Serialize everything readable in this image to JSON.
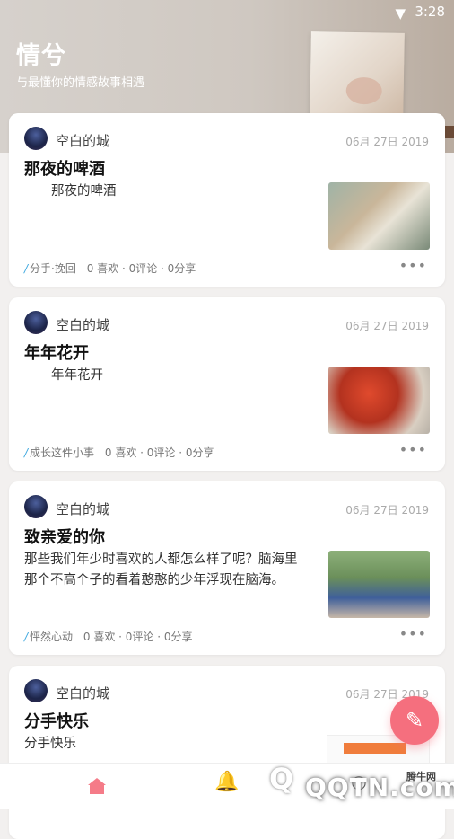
{
  "status_bar": {
    "time": "3:28",
    "wifi_icon": "wifi-icon"
  },
  "header": {
    "title": "情兮",
    "subtitle": "与最懂你的情感故事相遇"
  },
  "posts": [
    {
      "author": "空白的城",
      "date": "06月 27日 2019",
      "title": "那夜的啤酒",
      "body": "那夜的啤酒",
      "category": "分手·挽回",
      "stats": "0 喜欢 · 0评论 · 0分享",
      "thumb": "beer-photo"
    },
    {
      "author": "空白的城",
      "date": "06月 27日 2019",
      "title": "年年花开",
      "body": "年年花开",
      "category": "成长这件小事",
      "stats": "0 喜欢 · 0评论 · 0分享",
      "thumb": "flower-photo"
    },
    {
      "author": "空白的城",
      "date": "06月 27日 2019",
      "title": "致亲爱的你",
      "body": "那些我们年少时喜欢的人都怎么样了呢？脑海里那个不高个子的看着憨憨的少年浮现在脑海。",
      "category": "怦然心动",
      "stats": "0 喜欢 · 0评论 · 0分享",
      "thumb": "students-photo"
    },
    {
      "author": "空白的城",
      "date": "06月 27日 2019",
      "title": "分手快乐",
      "body": "分手快乐",
      "category": "",
      "stats": "",
      "thumb": "screenshot-photo"
    }
  ],
  "more_label": "•••",
  "fab": {
    "icon": "pen-icon",
    "glyph": "✎"
  },
  "bottom_nav": {
    "home_icon": "home-icon",
    "bell_icon": "bell-icon",
    "bell_glyph": "🔔",
    "profile_icon": "profile-icon"
  },
  "watermark": {
    "text": "QQTN.com",
    "small": "腾牛网",
    "badge": "Q"
  },
  "colors": {
    "accent": "#f56f7e",
    "category_slash": "#40a9e0"
  }
}
